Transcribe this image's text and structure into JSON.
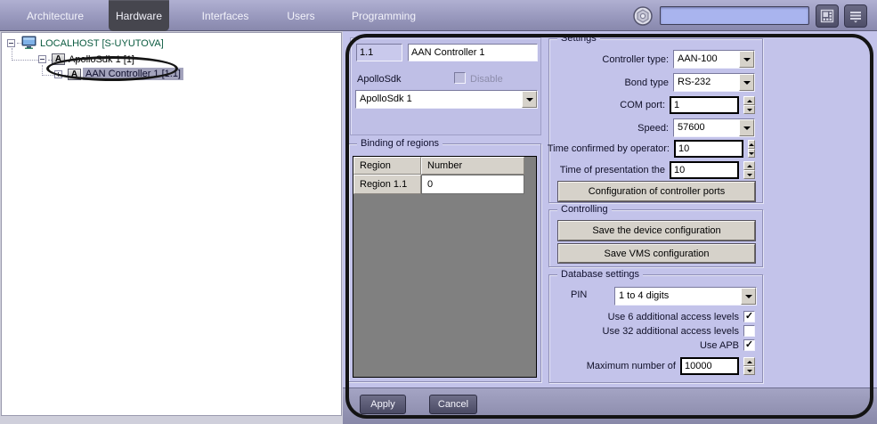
{
  "menu": {
    "items": [
      {
        "label": "Architecture",
        "active": false
      },
      {
        "label": "Hardware",
        "active": true
      },
      {
        "label": "Interfaces",
        "active": false
      },
      {
        "label": "Users",
        "active": false
      },
      {
        "label": "Programming",
        "active": false
      }
    ]
  },
  "topbar": {
    "search_value": ""
  },
  "icons": {
    "gear": "hex-nut-circle",
    "layout_grid": "screen-layout-squares",
    "menu_list": "three-bars-with-down-arrow",
    "monitor": "computer-monitor",
    "module": "letter-A-badge"
  },
  "tree": {
    "items": [
      {
        "label": "LOCALHOST [S-UYUTOVA]"
      },
      {
        "label": "ApolloSdk 1 [1]"
      },
      {
        "label": "AAN Controller 1 [1.1]"
      }
    ]
  },
  "panel": {
    "id_value": "1.1",
    "name_value": "AAN Controller 1",
    "parent_label": "ApolloSdk",
    "disable_label": "Disable",
    "parent_select_value": "ApolloSdk 1",
    "binding": {
      "title": "Binding of regions",
      "columns": [
        "Region",
        "Number"
      ],
      "rows": [
        [
          "Region 1.1",
          "0"
        ]
      ]
    },
    "settings": {
      "title": "Settings",
      "controller_type_label": "Controller type:",
      "controller_type_value": "AAN-100",
      "bond_type_label": "Bond type",
      "bond_type_value": "RS-232",
      "com_port_label": "COM port:",
      "com_port_value": "1",
      "speed_label": "Speed:",
      "speed_value": "57600",
      "time_confirmed_label": "Time confirmed by operator:",
      "time_confirmed_value": "10",
      "time_presentation_label": "Time of presentation the",
      "time_presentation_value": "10",
      "config_ports_button": "Configuration of controller ports"
    },
    "controlling": {
      "title": "Controlling",
      "save_device_button": "Save the device configuration",
      "save_vms_button": "Save VMS configuration"
    },
    "database": {
      "title": "Database settings",
      "pin_label": "PIN",
      "pin_value": "1 to 4 digits",
      "use6_label": "Use 6 additional access levels",
      "use6_checked": true,
      "use32_label": "Use 32 additional access levels",
      "use32_checked": false,
      "apb_label": "Use APB",
      "apb_checked": true,
      "max_label": "Maximum number of",
      "max_value": "10000"
    },
    "apply_button": "Apply",
    "cancel_button": "Cancel"
  },
  "glyphs": {
    "check": "✓"
  },
  "colors": {
    "menubar_top": "#b0b0d2",
    "menubar_bottom": "#8888ac",
    "active_tab": "#46464e",
    "panel_bg": "#c3c3ea",
    "panel_footer": "#8888a8",
    "tree_host_text": "#0b5b40",
    "selection_bg": "#a3a3bc",
    "annotation": "#151515",
    "button_face": "#d6d2ca",
    "dark_button": "#53536e",
    "search_field": "#a9b4ee",
    "table_bg": "#808080"
  }
}
